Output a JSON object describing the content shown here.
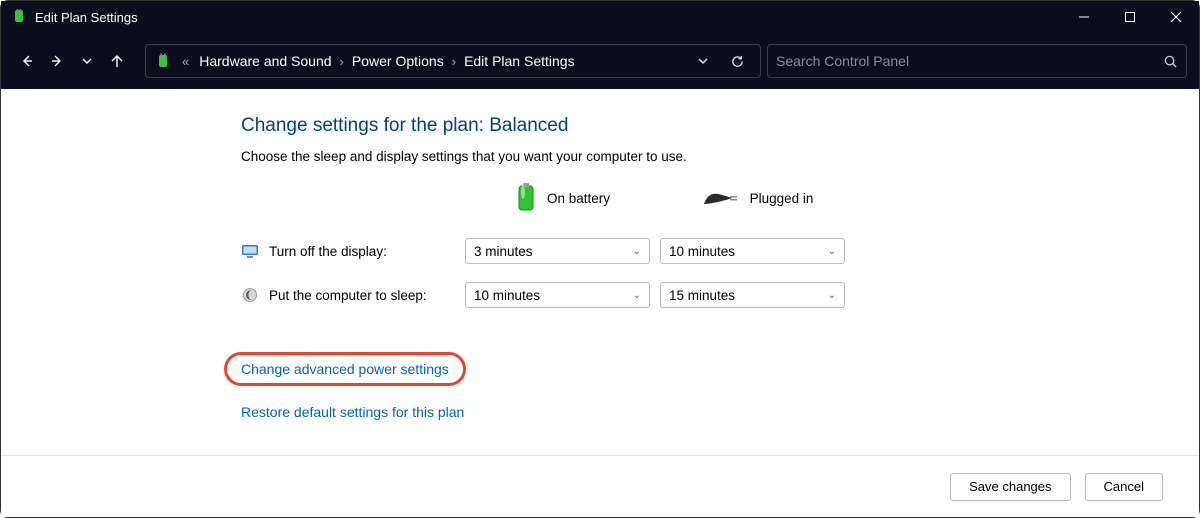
{
  "window": {
    "title": "Edit Plan Settings"
  },
  "breadcrumb": {
    "items": [
      "Hardware and Sound",
      "Power Options",
      "Edit Plan Settings"
    ]
  },
  "search": {
    "placeholder": "Search Control Panel"
  },
  "page": {
    "heading": "Change settings for the plan: Balanced",
    "subtext": "Choose the sleep and display settings that you want your computer to use.",
    "columns": {
      "battery": "On battery",
      "plugged": "Plugged in"
    },
    "rows": {
      "display": {
        "label": "Turn off the display:",
        "battery": "3 minutes",
        "plugged": "10 minutes"
      },
      "sleep": {
        "label": "Put the computer to sleep:",
        "battery": "10 minutes",
        "plugged": "15 minutes"
      }
    },
    "links": {
      "advanced": "Change advanced power settings",
      "restore": "Restore default settings for this plan"
    }
  },
  "footer": {
    "save": "Save changes",
    "cancel": "Cancel"
  }
}
